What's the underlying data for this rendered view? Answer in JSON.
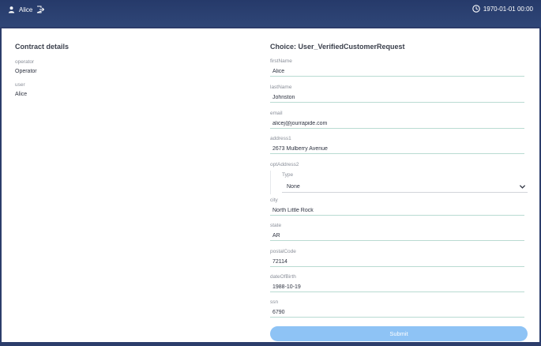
{
  "header": {
    "user_name": "Alice",
    "time": "1970-01-01 00:00",
    "icons": {
      "user": "user-icon",
      "logout": "logout-icon",
      "clock": "clock-icon"
    }
  },
  "contract": {
    "title": "Contract details",
    "fields": [
      {
        "label": "operator",
        "value": "Operator"
      },
      {
        "label": "user",
        "value": "Alice"
      }
    ]
  },
  "choice": {
    "title": "Choice: User_VerifiedCustomerRequest",
    "fields": {
      "firstName": {
        "label": "firstName",
        "value": "Alice"
      },
      "lastName": {
        "label": "lastName",
        "value": "Johnston"
      },
      "email": {
        "label": "email",
        "value": "alicej@jourrapide.com"
      },
      "address1": {
        "label": "address1",
        "value": "2673 Mulberry Avenue"
      },
      "optAddress2": {
        "label": "optAddress2",
        "type_label": "Type",
        "type_value": "None"
      },
      "city": {
        "label": "city",
        "value": "North Little Rock"
      },
      "state": {
        "label": "state",
        "value": "AR"
      },
      "postalCode": {
        "label": "postalCode",
        "value": "72114"
      },
      "dateOfBirth": {
        "label": "dateOfBirth",
        "value": "1988-10-19"
      },
      "ssn": {
        "label": "ssn",
        "value": "6790"
      }
    },
    "submit_label": "Submit"
  },
  "colors": {
    "header_bg": "#2c3d6b",
    "submit_bg": "#8ec3f5",
    "field_underline": "#b9dbd2"
  }
}
